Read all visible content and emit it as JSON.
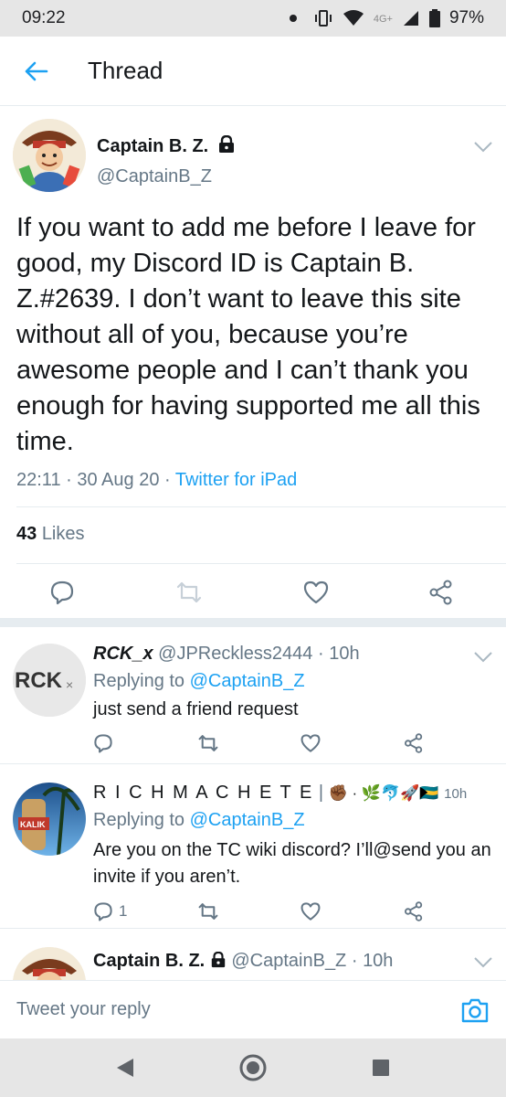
{
  "status_bar": {
    "time": "09:22",
    "network": "4G+",
    "battery": "97%"
  },
  "top_bar": {
    "title": "Thread"
  },
  "main_tweet": {
    "name": "Captain B. Z.",
    "handle": "@CaptainB_Z",
    "text": "If you want to add me before I leave for good, my Discord ID is Captain B. Z.#2639. I don’t want to leave this site without all of you, because you’re awesome people and I can’t thank you enough for having supported me all this time.",
    "time": "22:11",
    "date": "30 Aug 20",
    "source": "Twitter for iPad",
    "likes_count": "43",
    "likes_label": "Likes"
  },
  "replies": [
    {
      "name": "RCK_x",
      "handle": "@JPReckless2444",
      "age": "10h",
      "replying_label": "Replying to",
      "replying_to": "@CaptainB_Z",
      "text": "just send a friend request",
      "avatar_text": "RCK",
      "reply_count": ""
    },
    {
      "name": "R I C H   M A C H E T E",
      "handle": "",
      "age": "10h",
      "replying_label": "Replying to",
      "replying_to": "@CaptainB_Z",
      "text": "Are you on the TC wiki discord? I’ll@send you an invite if you aren’t.",
      "avatar_text": "KALIK",
      "reply_count": "1"
    },
    {
      "name": "Captain B. Z.",
      "handle": "@CaptainB_Z",
      "age": "10h"
    }
  ],
  "compose": {
    "placeholder": "Tweet your reply"
  },
  "colors": {
    "accent": "#1da1f2",
    "text": "#14171a",
    "secondary": "#657786",
    "divider": "#e6ecf0"
  },
  "icons": [
    "back-arrow-icon",
    "lock-icon",
    "chevron-down-icon",
    "reply-icon",
    "retweet-icon",
    "like-icon",
    "share-icon",
    "camera-icon",
    "nav-back-icon",
    "nav-home-icon",
    "nav-recents-icon"
  ]
}
